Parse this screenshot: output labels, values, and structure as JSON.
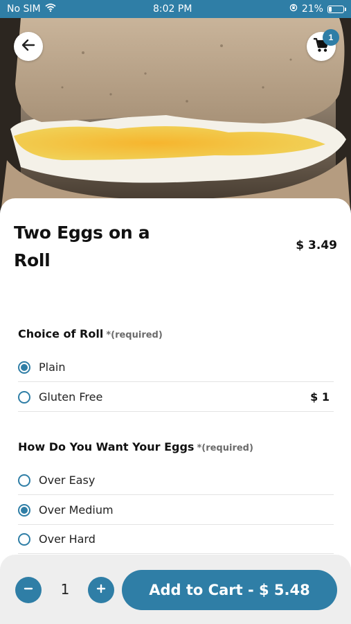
{
  "status_bar": {
    "carrier": "No SIM",
    "time": "8:02 PM",
    "battery_percent": "21%",
    "battery_level": 0.21
  },
  "header": {
    "back_icon": "arrow-left-icon",
    "cart_icon": "shopping-cart-icon",
    "cart_count": "1"
  },
  "item": {
    "name": "Two Eggs on a Roll",
    "price": "$ 3.49"
  },
  "sections": [
    {
      "title": "Choice of Roll",
      "required_label": "*(required)",
      "options": [
        {
          "label": "Plain",
          "price": "",
          "selected": true
        },
        {
          "label": "Gluten Free",
          "price": "$ 1",
          "selected": false
        }
      ]
    },
    {
      "title": "How Do You Want Your Eggs",
      "required_label": "*(required)",
      "options": [
        {
          "label": "Over Easy",
          "price": "",
          "selected": false
        },
        {
          "label": "Over Medium",
          "price": "",
          "selected": true
        },
        {
          "label": "Over Hard",
          "price": "",
          "selected": false
        }
      ]
    }
  ],
  "footer": {
    "quantity": "1",
    "minus_icon": "minus-icon",
    "plus_icon": "plus-icon",
    "add_to_cart_label": "Add to Cart - $ 5.48"
  },
  "colors": {
    "accent": "#2f7ea6",
    "footer_bg": "#eeeeee"
  }
}
